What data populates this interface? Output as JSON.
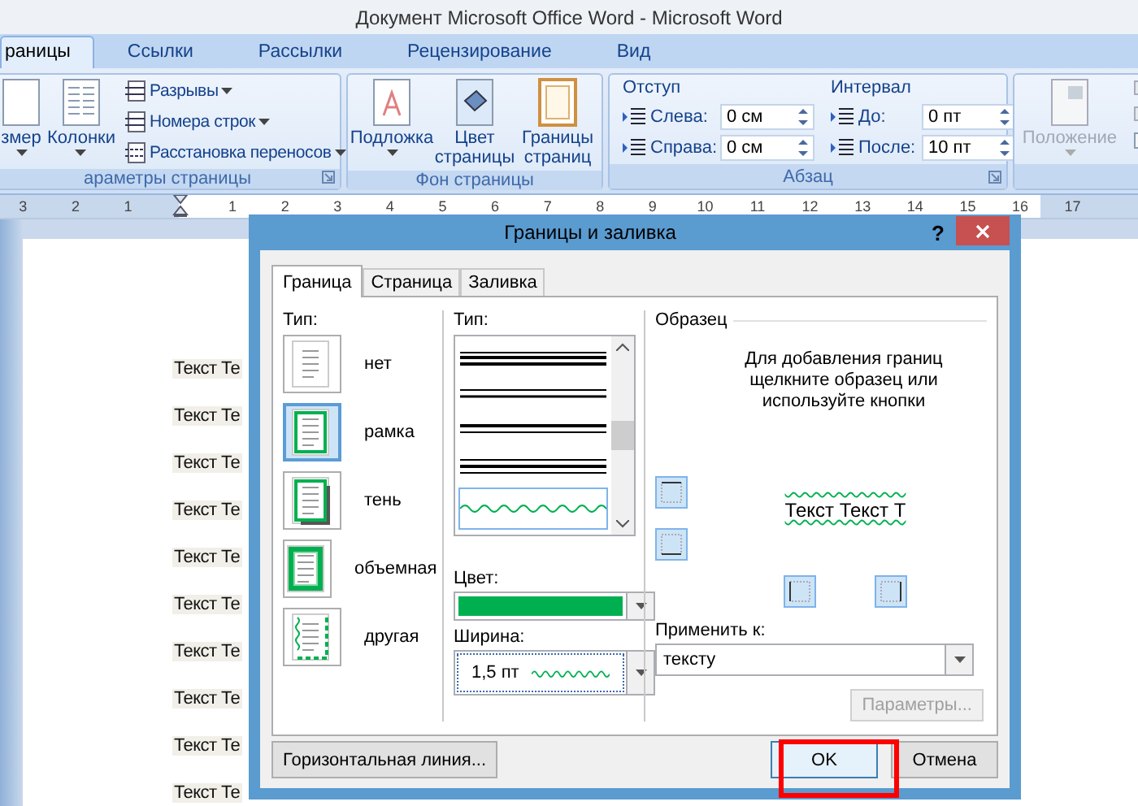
{
  "window": {
    "title": "Документ Microsoft Office Word - Microsoft Word"
  },
  "ribbon_tabs": [
    {
      "label": "раницы",
      "selected": true
    },
    {
      "label": "Ссылки",
      "selected": false
    },
    {
      "label": "Рассылки",
      "selected": false
    },
    {
      "label": "Рецензирование",
      "selected": false
    },
    {
      "label": "Вид",
      "selected": false
    }
  ],
  "ribbon": {
    "page_setup": {
      "large_buttons": [
        "змер",
        "Колонки"
      ],
      "small_buttons": [
        "Разрывы",
        "Номера строк",
        "Расстановка переносов"
      ],
      "label": "араметры страницы"
    },
    "page_background": {
      "buttons": [
        "Подложка",
        "Цвет страницы",
        "Границы страниц"
      ],
      "label": "Фон страницы"
    },
    "paragraph": {
      "columns": [
        {
          "title": "Отступ",
          "fields": [
            {
              "label": "Слева:",
              "value": "0 см"
            },
            {
              "label": "Справа:",
              "value": "0 см"
            }
          ]
        },
        {
          "title": "Интервал",
          "fields": [
            {
              "label": "До:",
              "value": "0 пт"
            },
            {
              "label": "После:",
              "value": "10 пт"
            }
          ]
        }
      ],
      "label": "Абзац"
    },
    "arrange": {
      "button": "Положение",
      "disabled": true
    }
  },
  "ruler": {
    "left_labels": [
      "3",
      "2",
      "1"
    ],
    "right_labels": [
      "1",
      "2",
      "3",
      "4",
      "5",
      "6",
      "7",
      "8",
      "9",
      "10",
      "11",
      "12",
      "13",
      "14",
      "15",
      "16",
      "17"
    ]
  },
  "document": {
    "lines": [
      "Текст Те",
      "Текст Те",
      "Текст Те",
      "Текст Те",
      "Текст Те",
      "Текст Те",
      "Текст Те",
      "Текст Те",
      "Текст Те",
      "Текст Те"
    ]
  },
  "dialog": {
    "title": "Границы и заливка",
    "help": "?",
    "tabs": [
      {
        "label": "Граница",
        "selected": true
      },
      {
        "label": "Страница",
        "selected": false
      },
      {
        "label": "Заливка",
        "selected": false
      }
    ],
    "setting": {
      "label": "Тип:",
      "options": [
        {
          "kind": "none",
          "label": "нет",
          "selected": false
        },
        {
          "kind": "box",
          "label": "рамка",
          "selected": true
        },
        {
          "kind": "shadow",
          "label": "тень",
          "selected": false
        },
        {
          "kind": "volume",
          "label": "объемная",
          "selected": false
        },
        {
          "kind": "custom",
          "label": "другая",
          "selected": false
        }
      ]
    },
    "style": {
      "label": "Тип:",
      "items": [
        {
          "kind": "triple",
          "selected": false
        },
        {
          "kind": "double",
          "selected": false
        },
        {
          "kind": "thick-thin",
          "selected": false
        },
        {
          "kind": "thin-thick-thin",
          "selected": false
        },
        {
          "kind": "wavy",
          "selected": true
        }
      ]
    },
    "color": {
      "label": "Цвет:",
      "color": "#00b050"
    },
    "width": {
      "label": "Ширина:",
      "value": "1,5 пт"
    },
    "preview": {
      "title": "Образец",
      "hint": "Для добавления границ щелкните образец или используйте кнопки",
      "sample": "Текст Текст Т"
    },
    "apply_to": {
      "label": "Применить к:",
      "value": "тексту"
    },
    "options_button": {
      "label": "Параметры...",
      "disabled": true
    },
    "horizontal_line_button": "Горизонтальная линия...",
    "ok_button": {
      "label": "OK",
      "highlighted": true
    },
    "cancel_button": "Отмена"
  }
}
